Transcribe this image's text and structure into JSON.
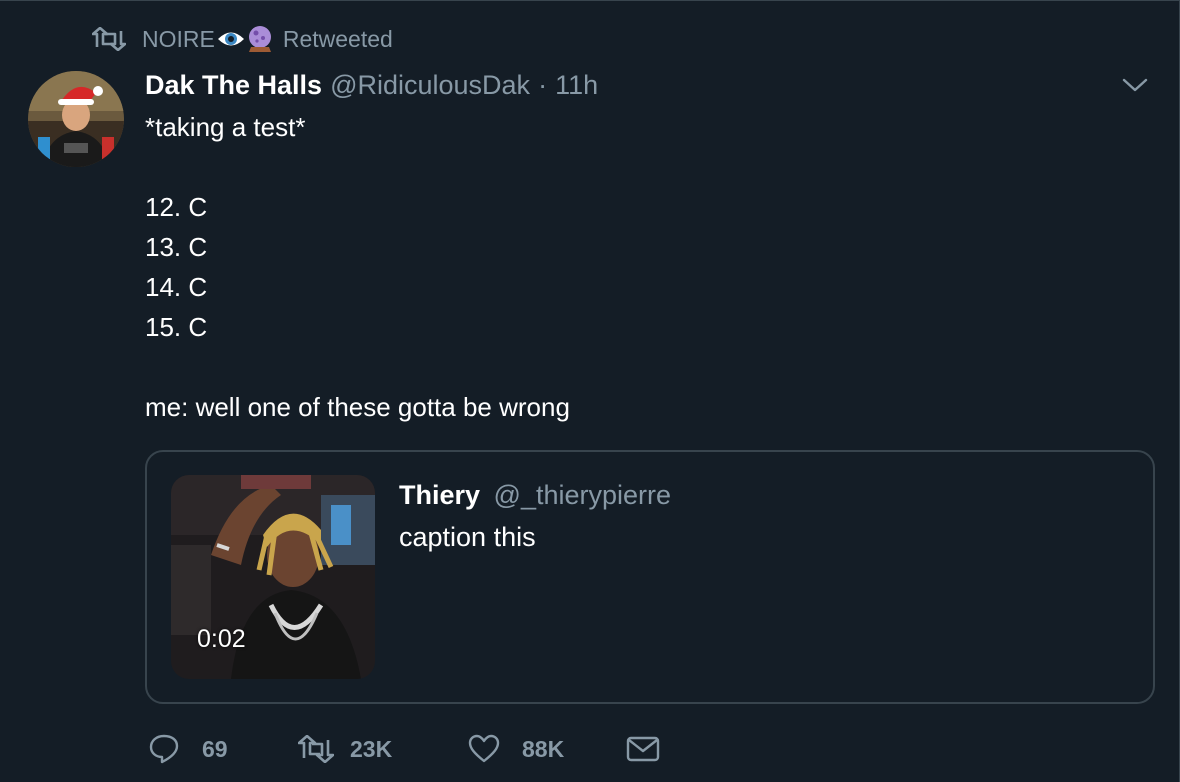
{
  "retweet_context": {
    "name": "NOIRE",
    "label": "Retweeted"
  },
  "tweet": {
    "author": {
      "display_name": "Dak The Halls",
      "handle": "@RidiculousDak"
    },
    "separator": "·",
    "time": "11h",
    "lines": [
      "*taking a test*",
      "",
      "12. C",
      "13. C",
      "14. C",
      "15. C",
      "",
      "me: well one of these gotta be wrong"
    ]
  },
  "quoted_tweet": {
    "display_name": "Thiery",
    "handle": "@_thierypierre",
    "text": "caption this",
    "video_duration": "0:02"
  },
  "actions": {
    "replies": "69",
    "retweets": "23K",
    "likes": "88K"
  },
  "colors": {
    "background": "#141d26",
    "secondary_text": "#8899a6",
    "border": "#38444d"
  }
}
